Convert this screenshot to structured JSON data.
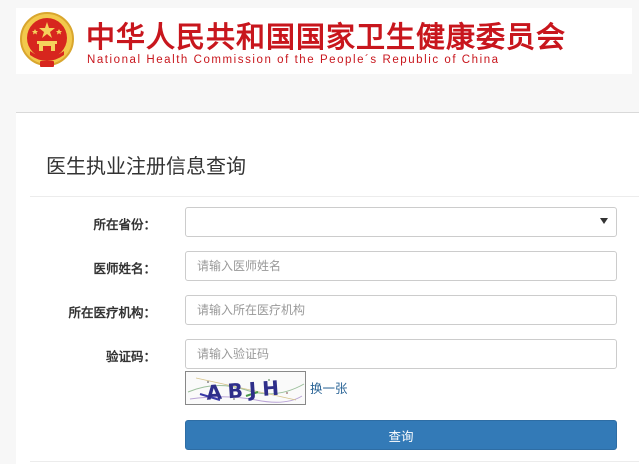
{
  "header": {
    "title_cn": "中华人民共和国国家卫生健康委员会",
    "title_en": "National Health Commission of the People´s Republic of China",
    "emblem_icon": "national-emblem-icon"
  },
  "form": {
    "title": "医生执业注册信息查询",
    "province": {
      "label": "所在省份：",
      "value": ""
    },
    "doctor_name": {
      "label": "医师姓名：",
      "placeholder": "请输入医师姓名"
    },
    "institution": {
      "label": "所在医疗机构：",
      "placeholder": "请输入所在医疗机构"
    },
    "captcha": {
      "label": "验证码：",
      "placeholder": "请输入验证码",
      "image_text": "ABJH",
      "refresh_label": "换一张"
    },
    "submit_label": "查询"
  },
  "colors": {
    "brand_red": "#c8161d",
    "primary_button": "#337ab7",
    "link": "#2a6496"
  }
}
